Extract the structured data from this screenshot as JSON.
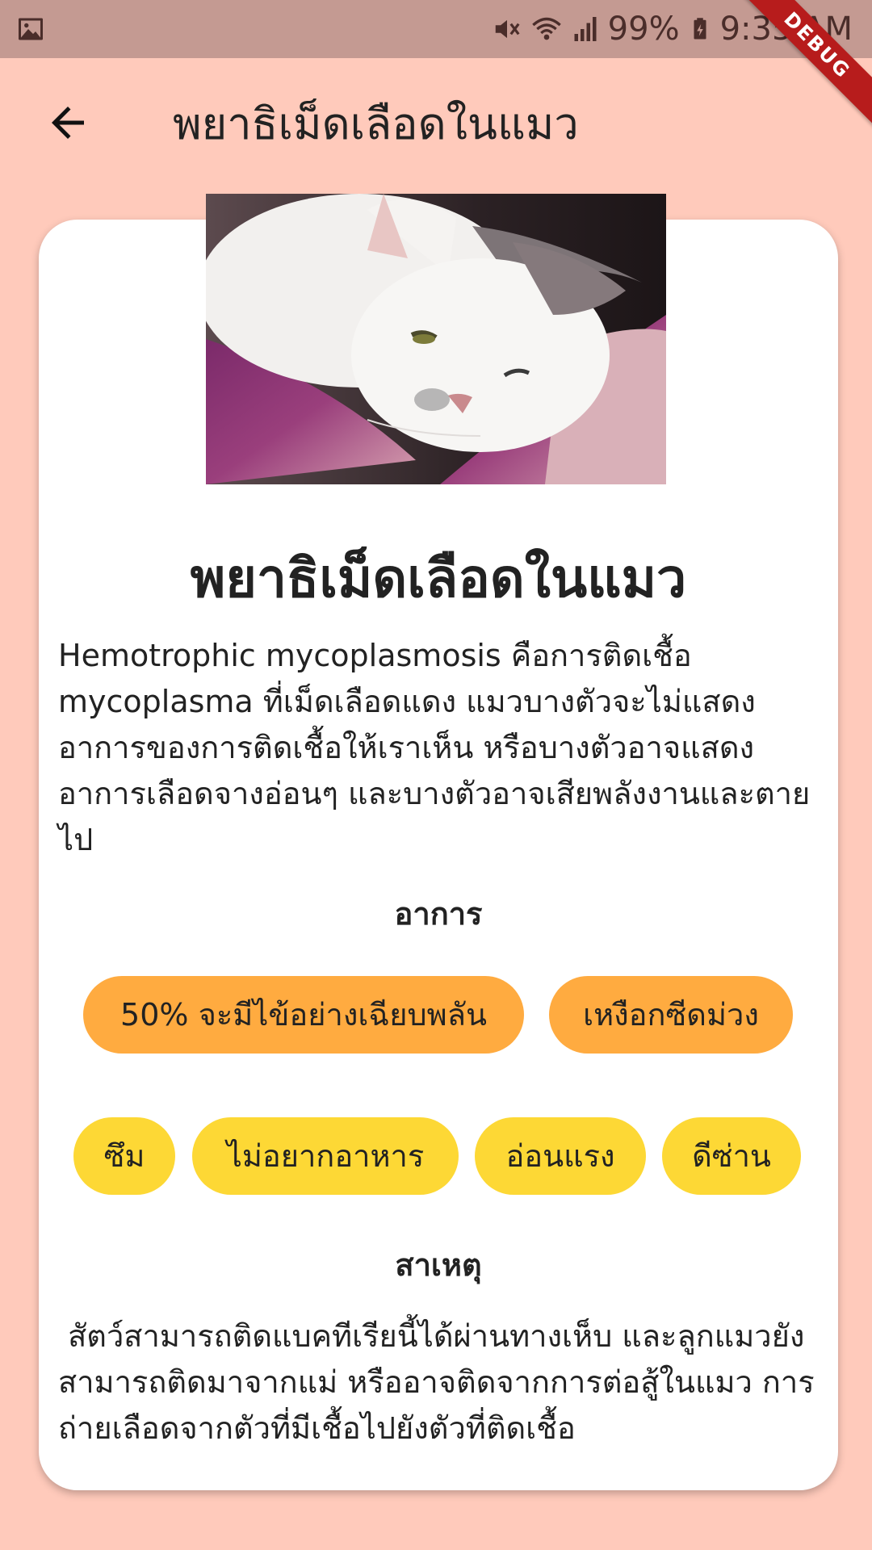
{
  "status_bar": {
    "battery": "99%",
    "time": "9:35 AM",
    "debug_label": "DEBUG",
    "icons": [
      "image-icon",
      "mute-icon",
      "wifi-icon",
      "signal-icon",
      "battery-icon"
    ]
  },
  "app_bar": {
    "title": "พยาธิเม็ดเลือดในแมว",
    "back_icon": "arrow-left-icon"
  },
  "card": {
    "image_description": "sleepy white and grey cat on a purple blanket",
    "title": "พยาธิเม็ดเลือดในแมว",
    "description": "Hemotrophic mycoplasmosis คือการติดเชื้อ mycoplasma ที่เม็ดเลือดแดง แมวบางตัวจะไม่แสดงอาการของการติดเชื้อให้เราเห็น หรือบางตัวอาจแสดงอาการเลือดจางอ่อนๆ และบางตัวอาจเสียพลังงานและตายไป",
    "symptoms_heading": "อาการ",
    "symptoms_primary": [
      "50% จะมีไข้อย่างเฉียบพลัน",
      "เหงือกซีดม่วง"
    ],
    "symptoms_secondary": [
      "ซึม",
      "ไม่อยากอาหาร",
      "อ่อนแรง",
      "ดีซ่าน"
    ],
    "cause_heading": "สาเหตุ",
    "cause_text": " สัตว์สามารถติดแบคทีเรียนี้ได้ผ่านทางเห็บ และลูกแมวยังสามารถติดมาจากแม่ หรืออาจติดจากการต่อสู้ในแมว การถ่ายเลือดจากตัวที่มีเชื้อไปยังตัวที่ติดเชื้อ"
  },
  "colors": {
    "background": "#ffcabb",
    "status_bar": "#c49a92",
    "card": "#ffffff",
    "chip_primary": "#ffab40",
    "chip_secondary": "#fdd835",
    "debug_ribbon": "#b71c1c"
  }
}
